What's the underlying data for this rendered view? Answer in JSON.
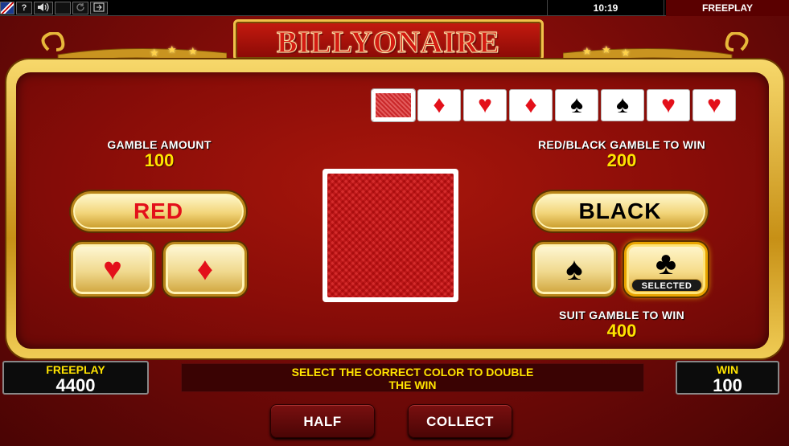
{
  "toolbar": {
    "help_label": "?",
    "sound_icon": "speaker-icon",
    "clock": "10:19",
    "mode": "FREEPLAY"
  },
  "title": "BILLYONAIRE",
  "history": [
    {
      "suit": "back"
    },
    {
      "suit": "diamond",
      "glyph": "♦",
      "color": "red"
    },
    {
      "suit": "heart",
      "glyph": "♥",
      "color": "red"
    },
    {
      "suit": "diamond",
      "glyph": "♦",
      "color": "red"
    },
    {
      "suit": "spade",
      "glyph": "♠",
      "color": "black"
    },
    {
      "suit": "spade",
      "glyph": "♠",
      "color": "black"
    },
    {
      "suit": "heart",
      "glyph": "♥",
      "color": "red"
    },
    {
      "suit": "heart",
      "glyph": "♥",
      "color": "red"
    }
  ],
  "gamble": {
    "amount_label": "GAMBLE AMOUNT",
    "amount_value": "100",
    "color_win_label": "RED/BLACK GAMBLE TO WIN",
    "color_win_value": "200",
    "suit_win_label": "SUIT GAMBLE TO WIN",
    "suit_win_value": "400"
  },
  "buttons": {
    "red": "RED",
    "black": "BLACK",
    "heart": "♥",
    "diamond": "♦",
    "spade": "♠",
    "club": "♣",
    "selected_tag": "SELECTED",
    "half": "HALF",
    "collect": "COLLECT"
  },
  "footer": {
    "balance_label": "FREEPLAY",
    "balance_value": "4400",
    "message_line1": "SELECT THE CORRECT COLOR TO DOUBLE",
    "message_line2": "THE WIN",
    "win_label": "WIN",
    "win_value": "100"
  },
  "colors": {
    "accent_gold": "#f0c24a",
    "value_yellow": "#ffe400",
    "red_suit": "#e3101a"
  }
}
